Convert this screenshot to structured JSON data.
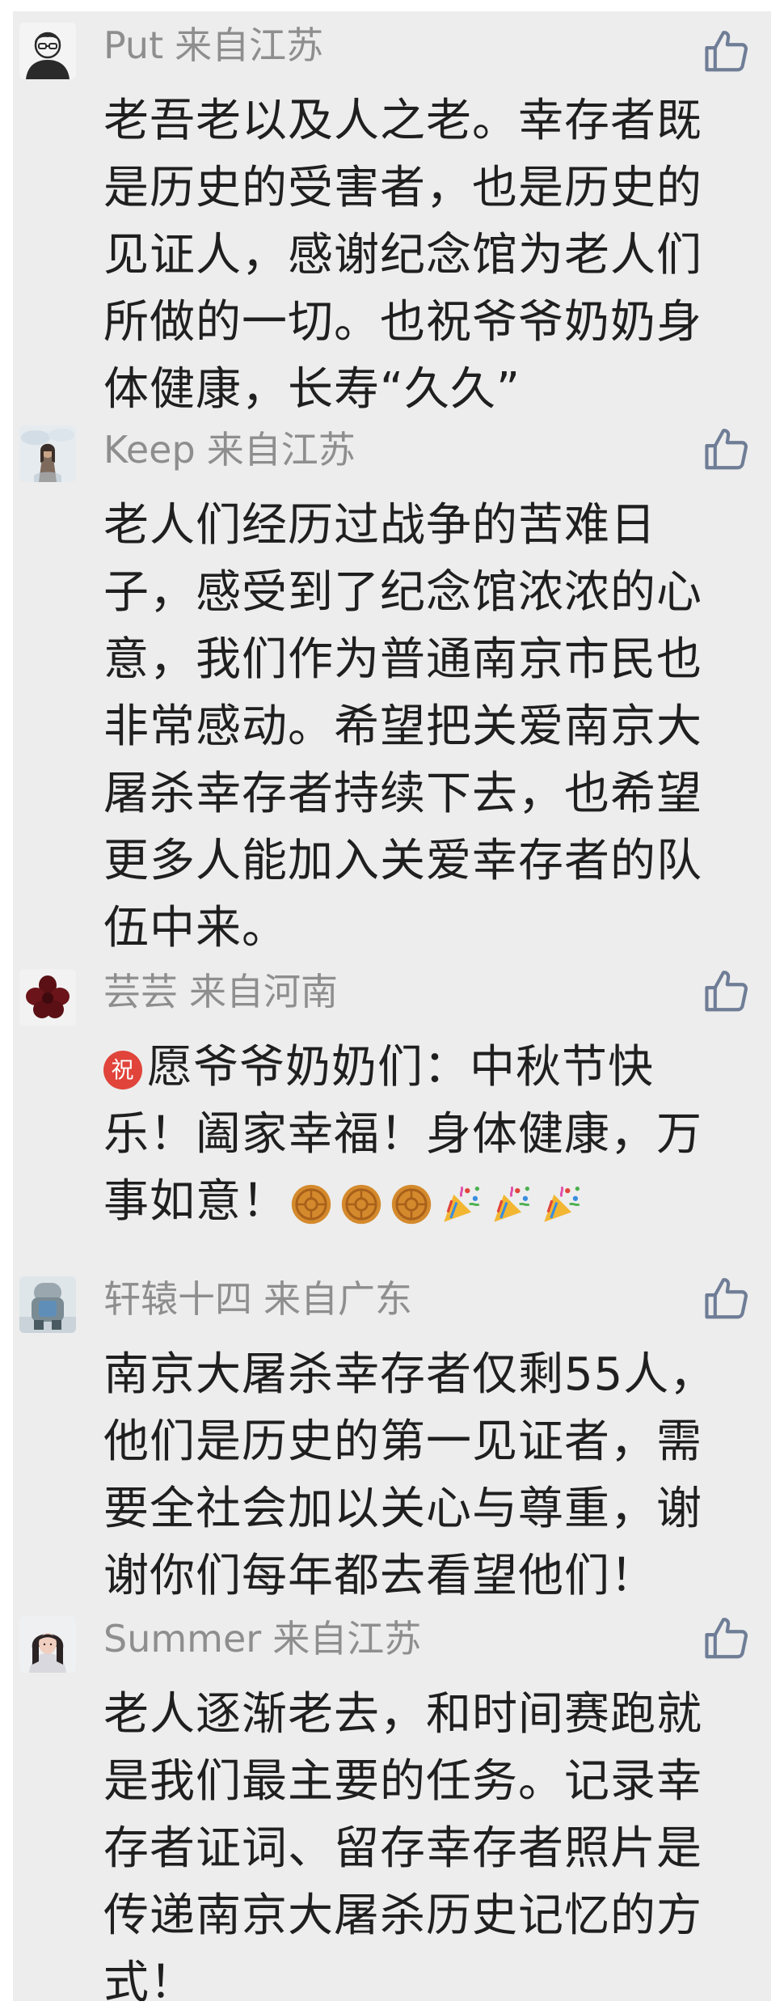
{
  "colors": {
    "background": "#ededed",
    "username": "#8e8e8e",
    "body_text": "#1f1f1f",
    "like_icon": "#6f7d96"
  },
  "comments": [
    {
      "username": "Put",
      "location": "来自江苏",
      "avatar_icon": "cartoon-person-avatar",
      "lines": [
        "老吾老以及人之老。幸存者既",
        "是历史的受害者，也是历史的",
        "见证人，感谢纪念馆为老人们",
        "所做的一切。也祝爷爷奶奶身",
        "体健康，长寿“久久”"
      ]
    },
    {
      "username": "Keep",
      "location": "来自江苏",
      "avatar_icon": "photo-person-avatar",
      "lines": [
        "老人们经历过战争的苦难日",
        "子，感受到了纪念馆浓浓的心",
        "意，我们作为普通南京市民也",
        "非常感动。希望把关爱南京大",
        "屠杀幸存者持续下去，也希望",
        "更多人能加入关爱幸存者的队",
        "伍中来。"
      ]
    },
    {
      "username": "芸芸",
      "location": "来自河南",
      "avatar_icon": "dark-red-flower-avatar",
      "emoji_line_1_prefix": "祝",
      "lines": [
        "愿爷爷奶奶们：中秋节快",
        "乐！阖家幸福！身体健康，万",
        "事如意！"
      ],
      "emojis": [
        "mooncake-emoji",
        "mooncake-emoji",
        "mooncake-emoji",
        "party-popper-emoji",
        "party-popper-emoji",
        "party-popper-emoji"
      ]
    },
    {
      "username": "轩辕十四",
      "location": "来自广东",
      "avatar_icon": "figurine-avatar",
      "lines": [
        "南京大屠杀幸存者仅剩55人，",
        "他们是历史的第一见证者，需",
        "要全社会加以关心与尊重，谢",
        "谢你们每年都去看望他们！"
      ]
    },
    {
      "username": "Summer",
      "location": "来自江苏",
      "avatar_icon": "girl-photo-avatar",
      "lines": [
        "老人逐渐老去，和时间赛跑就",
        "是我们最主要的任务。记录幸",
        "存者证词、留存幸存者照片是",
        "传递南京大屠杀历史记忆的方",
        "式！"
      ]
    }
  ]
}
